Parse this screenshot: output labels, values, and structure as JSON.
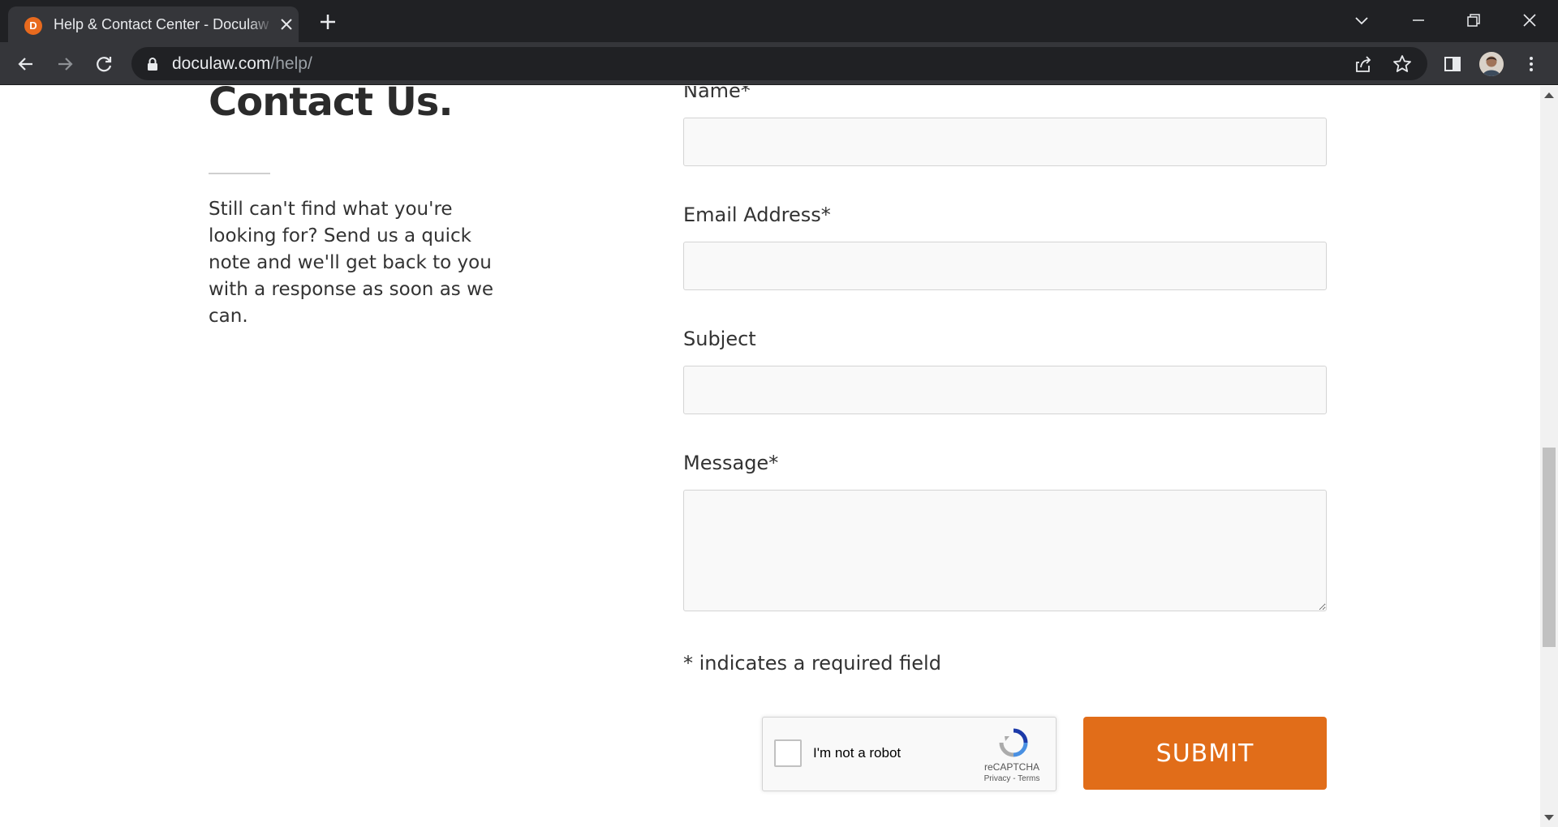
{
  "browser": {
    "tab_title": "Help & Contact Center - Doculaw",
    "favicon_letter": "D",
    "url_host": "doculaw.com",
    "url_path": "/help/"
  },
  "page": {
    "heading": "Contact Us.",
    "intro": "Still can't find what you're looking for? Send us a quick note and we'll get back to you with a response as soon as we can.",
    "form": {
      "name_label": "Name*",
      "email_label": "Email Address*",
      "subject_label": "Subject",
      "message_label": "Message*",
      "name_value": "",
      "email_value": "",
      "subject_value": "",
      "message_value": "",
      "required_note": "* indicates a required field",
      "submit_label": "SUBMIT"
    },
    "recaptcha": {
      "label": "I'm not a robot",
      "brand": "reCAPTCHA",
      "links": "Privacy - Terms"
    }
  },
  "colors": {
    "accent": "#e16d19",
    "tab_bar": "#202124",
    "toolbar": "#35363a"
  }
}
